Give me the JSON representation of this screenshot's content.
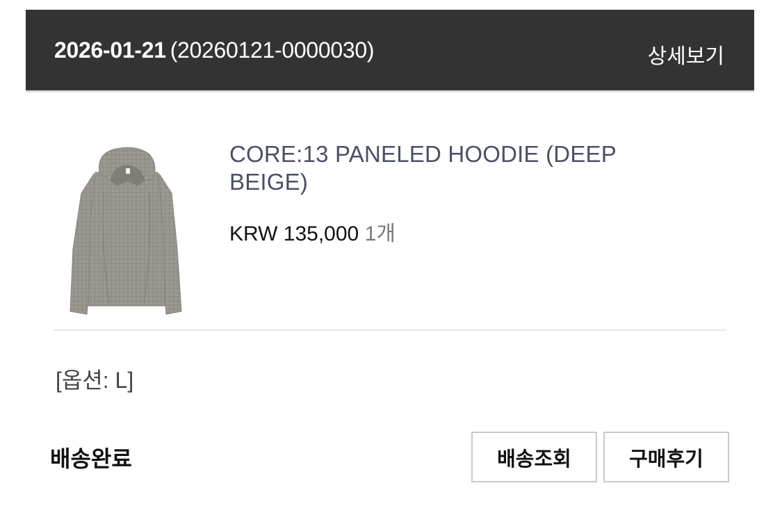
{
  "order": {
    "date": "2026-01-21",
    "number": "(20260121-0000030)",
    "detail_link": "상세보기"
  },
  "product": {
    "name": "CORE:13 PANELED HOODIE (DEEP BEIGE)",
    "price": "KRW 135,000",
    "quantity": "1개",
    "option": "[옵션: L]",
    "image_icon": "hoodie-image"
  },
  "status": "배송완료",
  "actions": {
    "tracking_label": "배송조회",
    "review_label": "구매후기"
  },
  "colors": {
    "header_bg": "#333333",
    "product_name": "#4a5065",
    "button_border": "#c9c9c9"
  }
}
